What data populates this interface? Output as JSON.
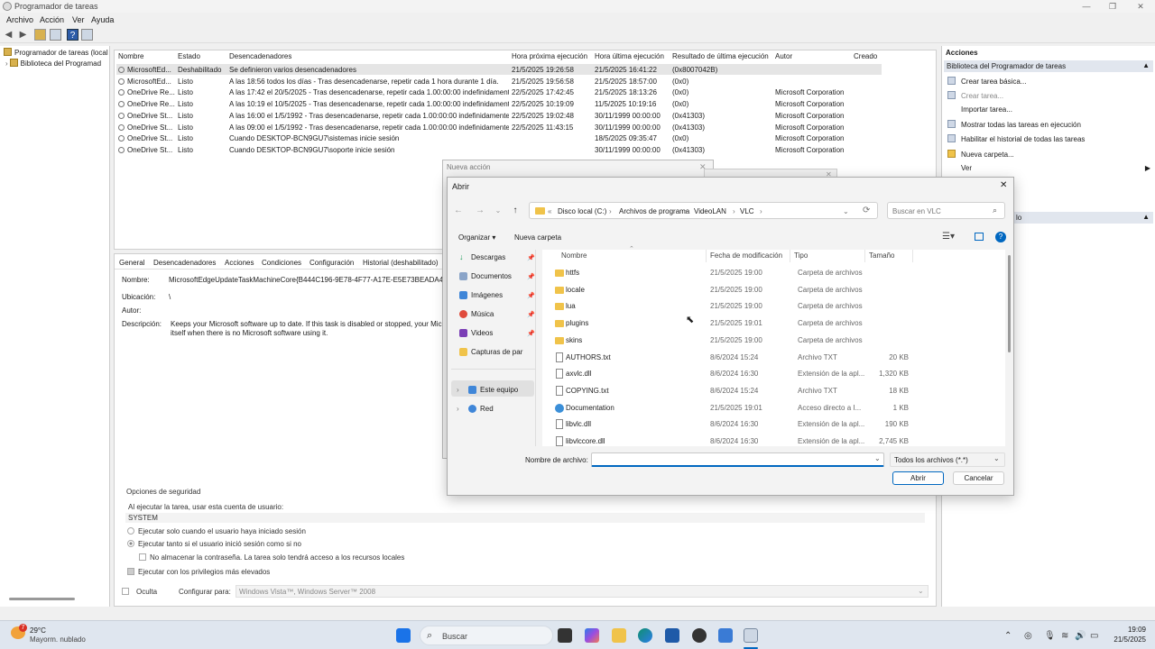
{
  "window": {
    "title": "Programador de tareas",
    "controls": [
      "—",
      "❐",
      "✕"
    ]
  },
  "menu": [
    "Archivo",
    "Acción",
    "Ver",
    "Ayuda"
  ],
  "tree": {
    "items": [
      "Programador de tareas (local",
      "Biblioteca del Programad"
    ]
  },
  "tasks": {
    "columns": [
      "Nombre",
      "Estado",
      "Desencadenadores",
      "Hora próxima ejecución",
      "Hora última ejecución",
      "Resultado de última ejecución",
      "Autor",
      "Creado"
    ],
    "rows": [
      [
        "MicrosoftEd...",
        "Deshabilitado",
        "Se definieron varios desencadenadores",
        "21/5/2025 19:26:58",
        "21/5/2025 16:41:22",
        "(0x8007042B)",
        "",
        ""
      ],
      [
        "MicrosoftEd...",
        "Listo",
        "A las 18:56 todos los días - Tras desencadenarse, repetir cada 1 hora durante 1 día.",
        "21/5/2025 19:56:58",
        "21/5/2025 18:57:00",
        "(0x0)",
        "",
        ""
      ],
      [
        "OneDrive Re...",
        "Listo",
        "A las 17:42 el 20/5/2025 - Tras desencadenarse, repetir cada 1.00:00:00 indefinidamente.",
        "22/5/2025 17:42:45",
        "21/5/2025 18:13:26",
        "(0x0)",
        "Microsoft Corporation",
        ""
      ],
      [
        "OneDrive Re...",
        "Listo",
        "A las 10:19 el 10/5/2025 - Tras desencadenarse, repetir cada 1.00:00:00 indefinidamente.",
        "22/5/2025 10:19:09",
        "11/5/2025 10:19:16",
        "(0x0)",
        "Microsoft Corporation",
        ""
      ],
      [
        "OneDrive St...",
        "Listo",
        "A las 16:00 el 1/5/1992 - Tras desencadenarse, repetir cada 1.00:00:00 indefinidamente.",
        "22/5/2025 19:02:48",
        "30/11/1999 00:00:00",
        "(0x41303)",
        "Microsoft Corporation",
        ""
      ],
      [
        "OneDrive St...",
        "Listo",
        "A las 09:00 el 1/5/1992 - Tras desencadenarse, repetir cada 1.00:00:00 indefinidamente.",
        "22/5/2025 11:43:15",
        "30/11/1999 00:00:00",
        "(0x41303)",
        "Microsoft Corporation",
        ""
      ],
      [
        "OneDrive St...",
        "Listo",
        "Cuando DESKTOP-BCN9GU7\\sistemas inicie sesión",
        "",
        "18/5/2025 09:35:47",
        "(0x0)",
        "Microsoft Corporation",
        ""
      ],
      [
        "OneDrive St...",
        "Listo",
        "Cuando DESKTOP-BCN9GU7\\soporte inicie sesión",
        "",
        "30/11/1999 00:00:00",
        "(0x41303)",
        "Microsoft Corporation",
        ""
      ]
    ]
  },
  "details": {
    "tabs": [
      "General",
      "Desencadenadores",
      "Acciones",
      "Condiciones",
      "Configuración",
      "Historial (deshabilitado)"
    ],
    "name_label": "Nombre:",
    "name_value": "MicrosoftEdgeUpdateTaskMachineCore{B444C196-9E78-4F77-A17E-E5E73BEADA46}",
    "location_label": "Ubicación:",
    "location_value": "\\",
    "author_label": "Autor:",
    "desc_label": "Descripción:",
    "desc_line1": "Keeps your Microsoft software up to date. If this task is disabled or stopped, your Micr",
    "desc_line2": "itself when there is no Microsoft software using it.",
    "security_title": "Opciones de seguridad",
    "run_as_label": "Al ejecutar la tarea, usar esta cuenta de usuario:",
    "run_as_value": "SYSTEM",
    "opt1": "Ejecutar solo cuando el usuario haya iniciado sesión",
    "opt2": "Ejecutar tanto si el usuario inició sesión como si no",
    "opt3": "No almacenar la contraseña. La tarea solo tendrá acceso a los recursos locales",
    "opt4": "Ejecutar con los privilegios más elevados",
    "hidden_label": "Oculta",
    "configure_label": "Configurar para:",
    "configure_value": "Windows Vista™, Windows Server™ 2008"
  },
  "actions": {
    "title": "Acciones",
    "section": "Biblioteca del Programador de tareas",
    "items": [
      "Crear tarea básica...",
      "Crear tarea...",
      "Importar tarea...",
      "Mostrar todas las tareas en ejecución",
      "Habilitar el historial de todas las tareas",
      "Nueva carpeta...",
      "Ver"
    ],
    "section2_tail": "lo"
  },
  "nueva_accion": {
    "title": "Nueva acción"
  },
  "open_dialog": {
    "title": "Abrir",
    "breadcrumb": [
      "Disco local (C:)",
      "Archivos de programa",
      "VideoLAN",
      "VLC"
    ],
    "search_placeholder": "Buscar en VLC",
    "organize": "Organizar ▾",
    "new_folder": "Nueva carpeta",
    "nav": [
      "Descargas",
      "Documentos",
      "Imágenes",
      "Música",
      "Videos",
      "Capturas de par",
      "Este equipo",
      "Red"
    ],
    "columns": [
      "Nombre",
      "Fecha de modificación",
      "Tipo",
      "Tamaño"
    ],
    "files": [
      {
        "name": "httfs",
        "date": "21/5/2025 19:00",
        "type": "Carpeta de archivos",
        "size": "",
        "kind": "folder"
      },
      {
        "name": "locale",
        "date": "21/5/2025 19:00",
        "type": "Carpeta de archivos",
        "size": "",
        "kind": "folder"
      },
      {
        "name": "lua",
        "date": "21/5/2025 19:00",
        "type": "Carpeta de archivos",
        "size": "",
        "kind": "folder"
      },
      {
        "name": "plugins",
        "date": "21/5/2025 19:01",
        "type": "Carpeta de archivos",
        "size": "",
        "kind": "folder"
      },
      {
        "name": "skins",
        "date": "21/5/2025 19:00",
        "type": "Carpeta de archivos",
        "size": "",
        "kind": "folder"
      },
      {
        "name": "AUTHORS.txt",
        "date": "8/6/2024 15:24",
        "type": "Archivo TXT",
        "size": "20 KB",
        "kind": "file"
      },
      {
        "name": "axvlc.dll",
        "date": "8/6/2024 16:30",
        "type": "Extensión de la apl...",
        "size": "1,320 KB",
        "kind": "file"
      },
      {
        "name": "COPYING.txt",
        "date": "8/6/2024 15:24",
        "type": "Archivo TXT",
        "size": "18 KB",
        "kind": "file"
      },
      {
        "name": "Documentation",
        "date": "21/5/2025 19:01",
        "type": "Acceso directo a I...",
        "size": "1 KB",
        "kind": "link"
      },
      {
        "name": "libvlc.dll",
        "date": "8/6/2024 16:30",
        "type": "Extensión de la apl...",
        "size": "190 KB",
        "kind": "file"
      },
      {
        "name": "libvlccore.dll",
        "date": "8/6/2024 16:30",
        "type": "Extensión de la apl...",
        "size": "2,745 KB",
        "kind": "file"
      }
    ],
    "filename_label": "Nombre de archivo:",
    "filename_value": "",
    "filetype": "Todos los archivos (*.*)",
    "open_btn": "Abrir",
    "cancel_btn": "Cancelar"
  },
  "taskbar": {
    "weather_temp": "29°C",
    "weather_desc": "Mayorm. nublado",
    "weather_badge": "7",
    "search": "Buscar",
    "time": "19:09",
    "date": "21/5/2025"
  },
  "colors": {
    "accent": "#0067c0",
    "folder": "#f0c34a",
    "actions_header": "#e1e6ee"
  }
}
